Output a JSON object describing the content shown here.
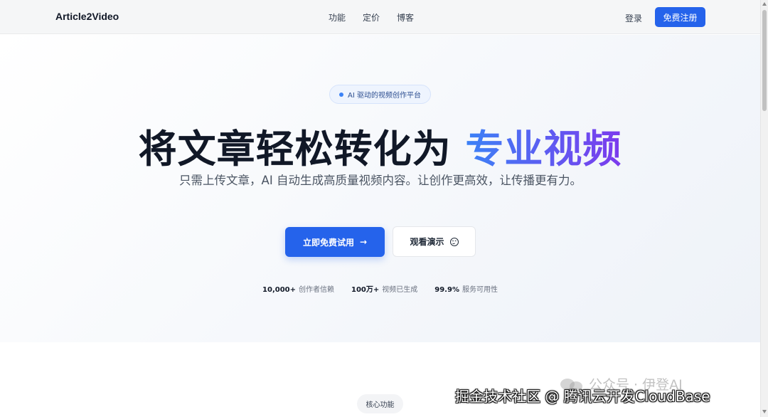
{
  "nav": {
    "brand": "Article2Video",
    "links": [
      "功能",
      "定价",
      "博客"
    ],
    "login": "登录",
    "signup": "免费注册"
  },
  "hero": {
    "badge": "AI 驱动的视频创作平台",
    "headline_main": "将文章轻松转化为 ",
    "headline_accent": "专业视频",
    "subtitle": "只需上传文章，AI 自动生成高质量视频内容。让创作更高效，让传播更有力。",
    "cta_primary": "立即免费试用",
    "cta_primary_icon": "→",
    "cta_secondary": "观看演示",
    "stats": [
      {
        "value": "10,000+",
        "label": "创作者信赖"
      },
      {
        "value": "100万+",
        "label": "视频已生成"
      },
      {
        "value": "99.9%",
        "label": "服务可用性"
      }
    ]
  },
  "features": {
    "badge": "核心功能"
  },
  "watermark": {
    "top": "公众号 · 伊登AI",
    "bottom": "掘金技术社区 @ 腾讯云开发CloudBase"
  },
  "colors": {
    "primary": "#2563eb",
    "gradient_start": "#3b82f6",
    "gradient_end": "#7c3aed"
  }
}
